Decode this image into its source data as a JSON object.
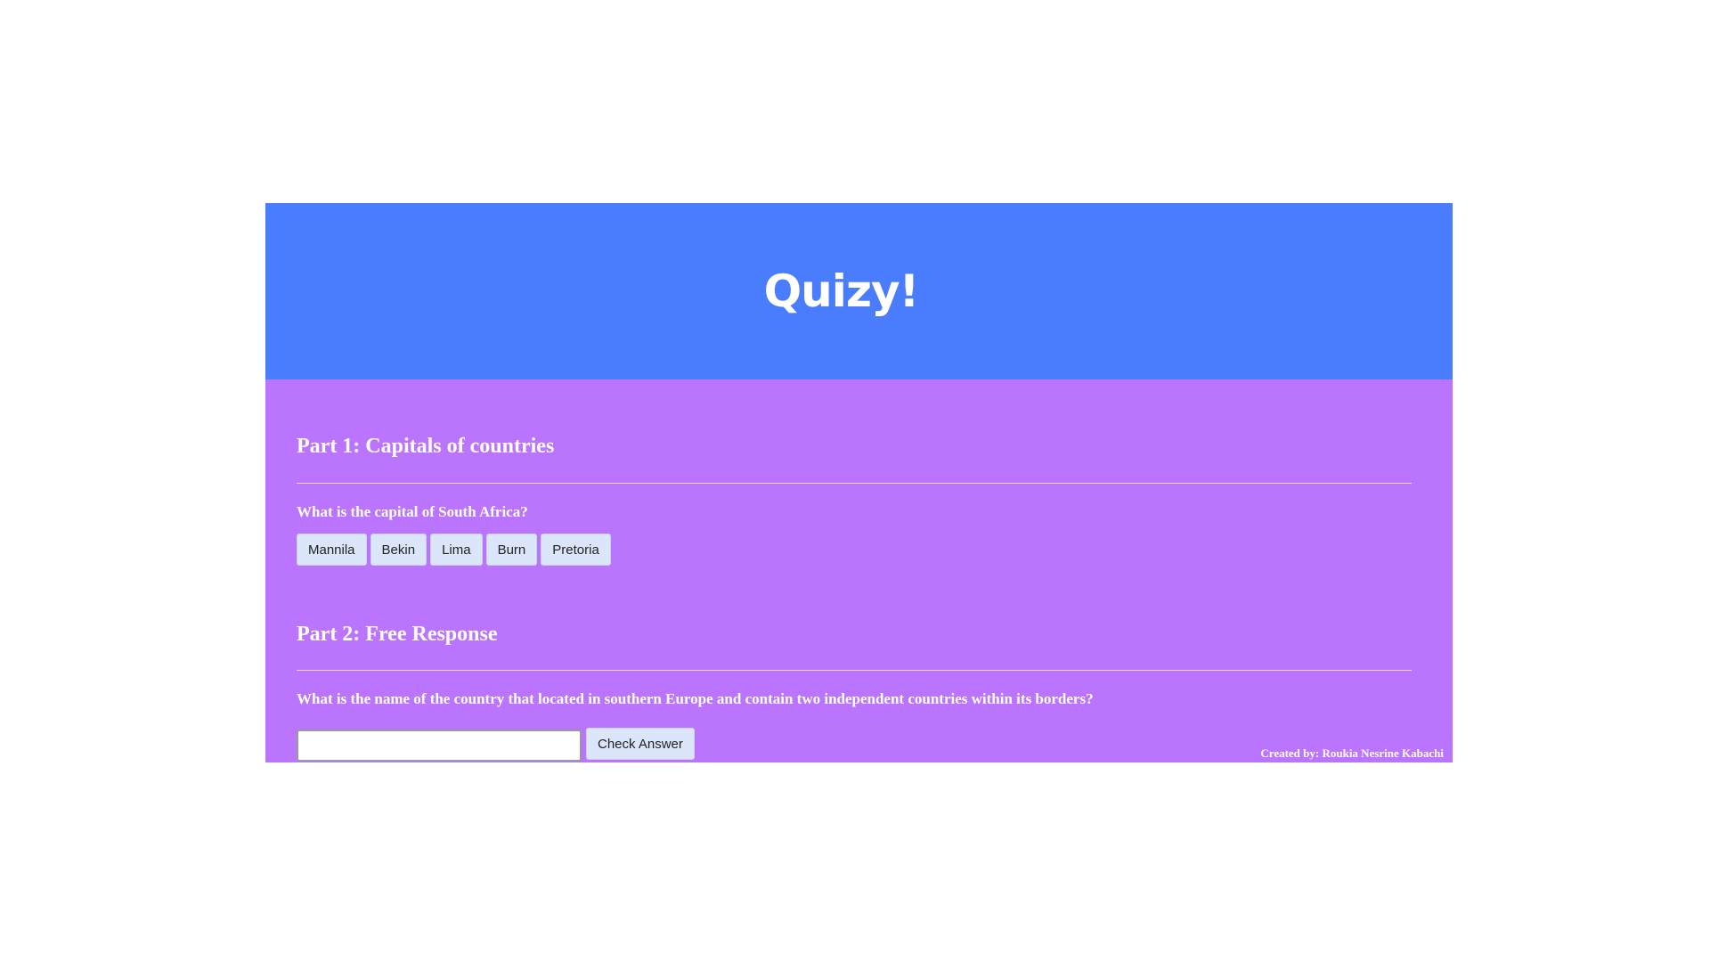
{
  "header": {
    "title": "Quizy!"
  },
  "part1": {
    "title": "Part 1: Capitals of countries",
    "question": "What is the capital of South Africa?",
    "options": [
      "Mannila",
      "Bekin",
      "Lima",
      "Burn",
      "Pretoria"
    ]
  },
  "part2": {
    "title": "Part 2: Free Response",
    "question": "What is the name of the country that located in southern Europe and contain two independent countries within its borders?",
    "input_value": "",
    "check_label": "Check Answer"
  },
  "footer": {
    "credit": "Created by: Roukia Nesrine Kabachi"
  },
  "colors": {
    "header_bg": "#4a7dfe",
    "content_bg": "#bb74fd",
    "button_bg": "#dbe6fb"
  }
}
